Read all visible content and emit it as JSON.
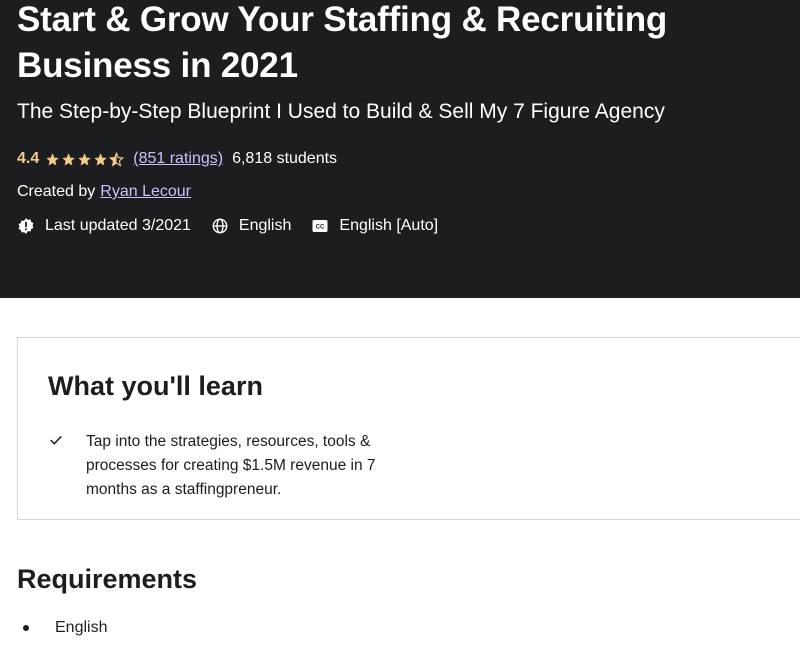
{
  "course": {
    "title": "Start & Grow Your Staffing & Recruiting Business in 2021",
    "subtitle": "The Step-by-Step Blueprint I Used to Build & Sell My 7 Figure Agency",
    "rating": "4.4",
    "rating_stars": 4.5,
    "ratings_link": "(851 ratings)",
    "students": "6,818 students",
    "created_label": "Created by",
    "author": "Ryan Lecour",
    "last_updated": "Last updated 3/2021",
    "language": "English",
    "captions": "English [Auto]"
  },
  "learn": {
    "title": "What you'll learn",
    "items": [
      "Tap into the strategies, resources, tools & processes for creating $1.5M revenue in 7 months as a staffingpreneur."
    ]
  },
  "requirements": {
    "title": "Requirements",
    "items": [
      "English"
    ]
  },
  "colors": {
    "hero_background": "#1c1d1f",
    "rating_gold": "#f3ca8c",
    "link_purple": "#cec0fc"
  },
  "icons": {
    "star": "star-icon",
    "update": "alert-badge-icon",
    "language": "globe-icon",
    "captions": "closed-captions-icon",
    "check": "check-icon"
  }
}
